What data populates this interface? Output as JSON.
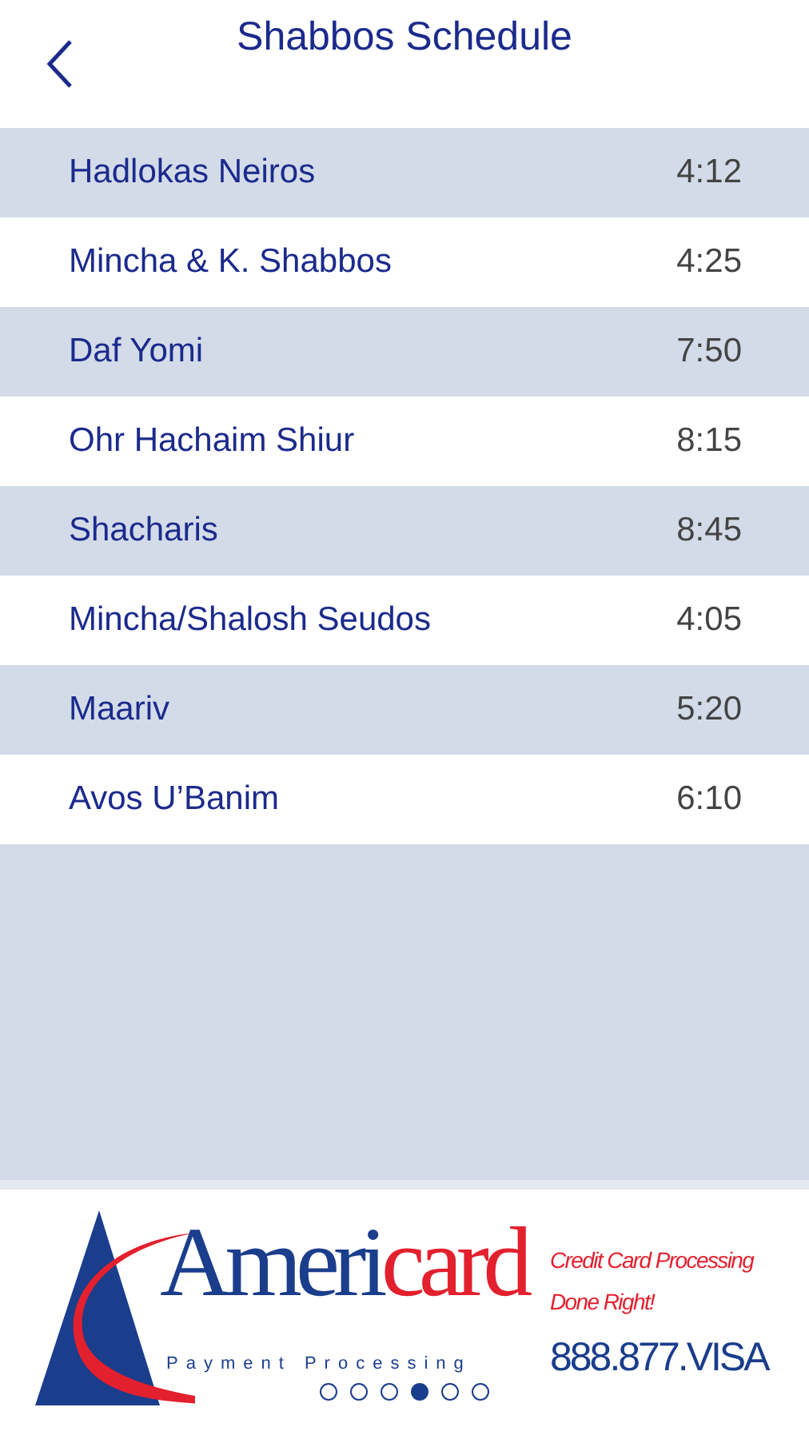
{
  "header": {
    "title": "Shabbos Schedule"
  },
  "schedule": [
    {
      "name": "Hadlokas Neiros",
      "time": "4:12"
    },
    {
      "name": "Mincha & K. Shabbos",
      "time": "4:25"
    },
    {
      "name": "Daf Yomi",
      "time": "7:50"
    },
    {
      "name": "Ohr Hachaim Shiur",
      "time": "8:15"
    },
    {
      "name": "Shacharis",
      "time": "8:45"
    },
    {
      "name": "Mincha/Shalosh Seudos",
      "time": "4:05"
    },
    {
      "name": "Maariv",
      "time": "5:20"
    },
    {
      "name": "Avos U’Banim",
      "time": "6:10"
    }
  ],
  "ad": {
    "brand_part_1": "Ameri",
    "brand_part_2": "card",
    "tagline": "Payment Processing",
    "slogan_line_1": "Credit Card Processing",
    "slogan_line_2": "Done Right!",
    "phone": "888.877.VISA",
    "dots": [
      {
        "selected": false
      },
      {
        "selected": false
      },
      {
        "selected": false
      },
      {
        "selected": true
      },
      {
        "selected": false
      },
      {
        "selected": false
      }
    ]
  }
}
